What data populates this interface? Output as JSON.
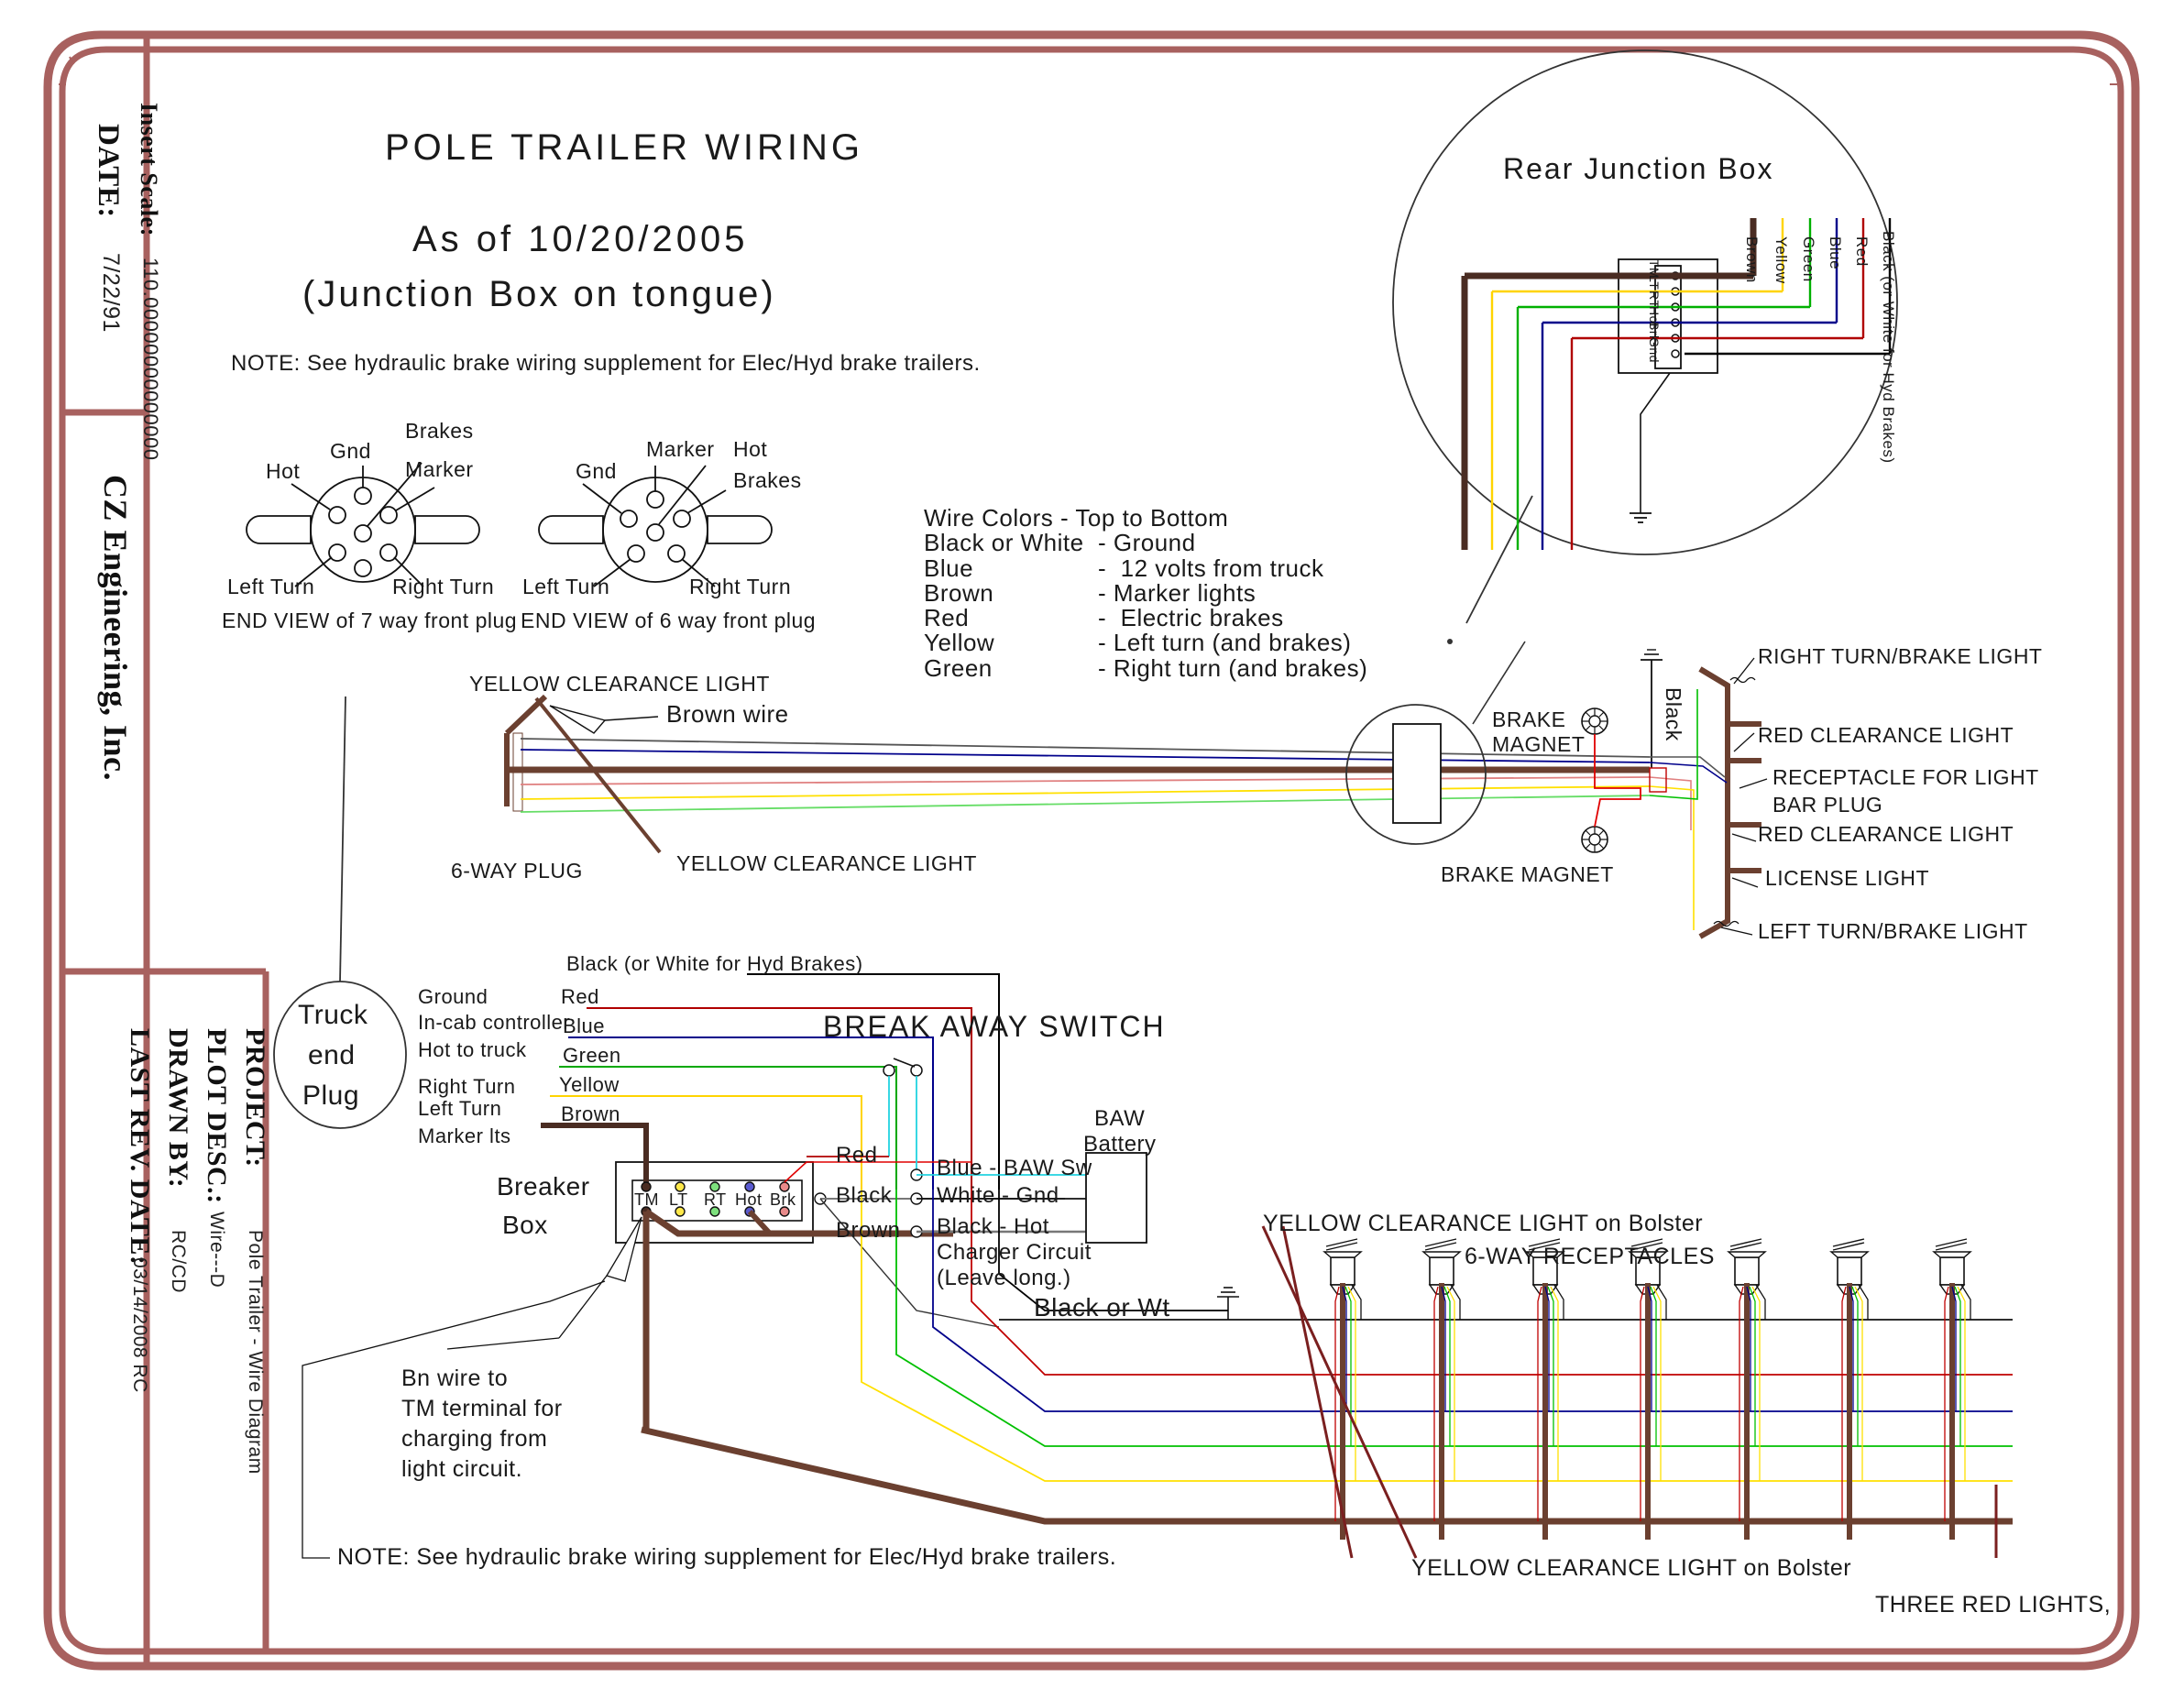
{
  "sheet": {
    "border_color": "#a8615f",
    "background": "#ffffff"
  },
  "title_block": {
    "date_label": "DATE:",
    "date_value": "7/22/91",
    "company": "CZ Engineering, Inc.",
    "insert_scale_label": "Insert Scale:",
    "insert_scale_value": "110.00000000000000",
    "project_label": "PROJECT:",
    "project_value": "Pole Trailer - Wire Diagram",
    "plot_desc_label": "PLOT DESC.:",
    "plot_desc_value": "Wire---D",
    "drawn_by_label": "DRAWN BY:",
    "drawn_by_value": "RC/CD",
    "last_rev_label": "LAST REV. DATE:",
    "last_rev_value": "03/14/2008 RC"
  },
  "header": {
    "title": "POLE TRAILER WIRING",
    "subtitle1": "As of 10/20/2005",
    "subtitle2": "(Junction Box on tongue)",
    "note": "NOTE: See hydraulic brake wiring supplement for Elec/Hyd brake trailers."
  },
  "plug7": {
    "caption": "END VIEW of 7 way front plug",
    "labels": {
      "hot": "Hot",
      "gnd": "Gnd",
      "brakes": "Brakes",
      "marker": "Marker",
      "left_turn": "Left Turn",
      "right_turn": "Right Turn"
    }
  },
  "plug6": {
    "caption": "END VIEW of 6 way front plug",
    "labels": {
      "gnd": "Gnd",
      "marker": "Marker",
      "hot": "Hot",
      "brakes": "Brakes",
      "left_turn": "Left Turn",
      "right_turn": "Right Turn"
    }
  },
  "wire_legend": {
    "heading": "Wire Colors - Top to Bottom",
    "rows": [
      {
        "name": "Black or White",
        "desc": "- Ground",
        "hex": "#000000"
      },
      {
        "name": "Blue",
        "desc": "-  12 volts from truck",
        "hex": "#00008b"
      },
      {
        "name": "Brown",
        "desc": "- Marker lights",
        "hex": "#5c3228"
      },
      {
        "name": "Red",
        "desc": "-  Electric brakes",
        "hex": "#c00000"
      },
      {
        "name": "Yellow",
        "desc": "- Left turn (and brakes)",
        "hex": "#ffe000"
      },
      {
        "name": "Green",
        "desc": "- Right turn (and brakes)",
        "hex": "#00b000"
      }
    ]
  },
  "rear_junction_box": {
    "title": "Rear Junction Box",
    "terminals": [
      "TM",
      "LT",
      "RT",
      "Hot",
      "Brk",
      "Gnd"
    ],
    "wire_labels": [
      {
        "text": "Brown",
        "hex": "#4a2c22"
      },
      {
        "text": "Yellow",
        "hex": "#ffd400"
      },
      {
        "text": "Green",
        "hex": "#00a800"
      },
      {
        "text": "Blue",
        "hex": "#00008b"
      },
      {
        "text": "Red",
        "hex": "#b00000"
      },
      {
        "text": "Black (or White for Hyd Brakes)",
        "hex": "#000000"
      }
    ]
  },
  "harness": {
    "yellow_clearance_top": "YELLOW CLEARANCE LIGHT",
    "brown_wire": "Brown wire",
    "six_way_plug": "6-WAY PLUG",
    "yellow_clearance_bottom": "YELLOW CLEARANCE LIGHT",
    "brake_magnet_top": "BRAKE\nMAGNET",
    "brake_magnet_bottom": "BRAKE MAGNET",
    "black_vertical": "Black"
  },
  "rear_lights": [
    "RIGHT TURN/BRAKE LIGHT",
    "RED CLEARANCE LIGHT",
    "RECEPTACLE FOR LIGHT",
    "BAR PLUG",
    "RED CLEARANCE LIGHT",
    "LICENSE LIGHT",
    "LEFT TURN/BRAKE LIGHT"
  ],
  "truck_plug": {
    "line1": "Truck",
    "line2": "end",
    "line3": "Plug",
    "functions": [
      "Ground",
      "In-cab controller",
      "Hot to truck",
      "Right Turn",
      "Left Turn",
      "Marker lts"
    ]
  },
  "breaker_box": {
    "label_line1": "Breaker",
    "label_line2": "Box",
    "terminals": [
      "TM",
      "LT",
      "RT",
      "Hot",
      "Brk"
    ],
    "wire_labels": [
      {
        "text": "Black (or White for Hyd Brakes)",
        "hex": "#000000"
      },
      {
        "text": "Red",
        "hex": "#b00000"
      },
      {
        "text": "Blue",
        "hex": "#00008b"
      },
      {
        "text": "Green",
        "hex": "#00a800"
      },
      {
        "text": "Yellow",
        "hex": "#ffd400"
      },
      {
        "text": "Brown",
        "hex": "#4a2c22"
      }
    ],
    "note": "Bn wire to\nTM terminal for\ncharging from\nlight circuit."
  },
  "break_away": {
    "title": "BREAK AWAY SWITCH",
    "battery_line1": "BAW",
    "battery_line2": "Battery",
    "in_labels": [
      "Red",
      "Black",
      "Brown"
    ],
    "out_labels": [
      "Blue - BAW Sw",
      "White - Gnd",
      "Black - Hot",
      "Charger Circuit",
      "(Leave long.)"
    ]
  },
  "bottom": {
    "black_or_wt": "Black or Wt",
    "yellow_clearance_bolster_top": "YELLOW CLEARANCE LIGHT on Bolster",
    "six_way_receptacles": "6-WAY RECEPTACLES",
    "yellow_clearance_bolster_bottom": "YELLOW CLEARANCE LIGHT on Bolster",
    "three_red_lights": "THREE RED LIGHTS,",
    "note": "NOTE: See hydraulic brake wiring supplement for Elec/Hyd brake trailers.",
    "receptacle_count": 7
  }
}
